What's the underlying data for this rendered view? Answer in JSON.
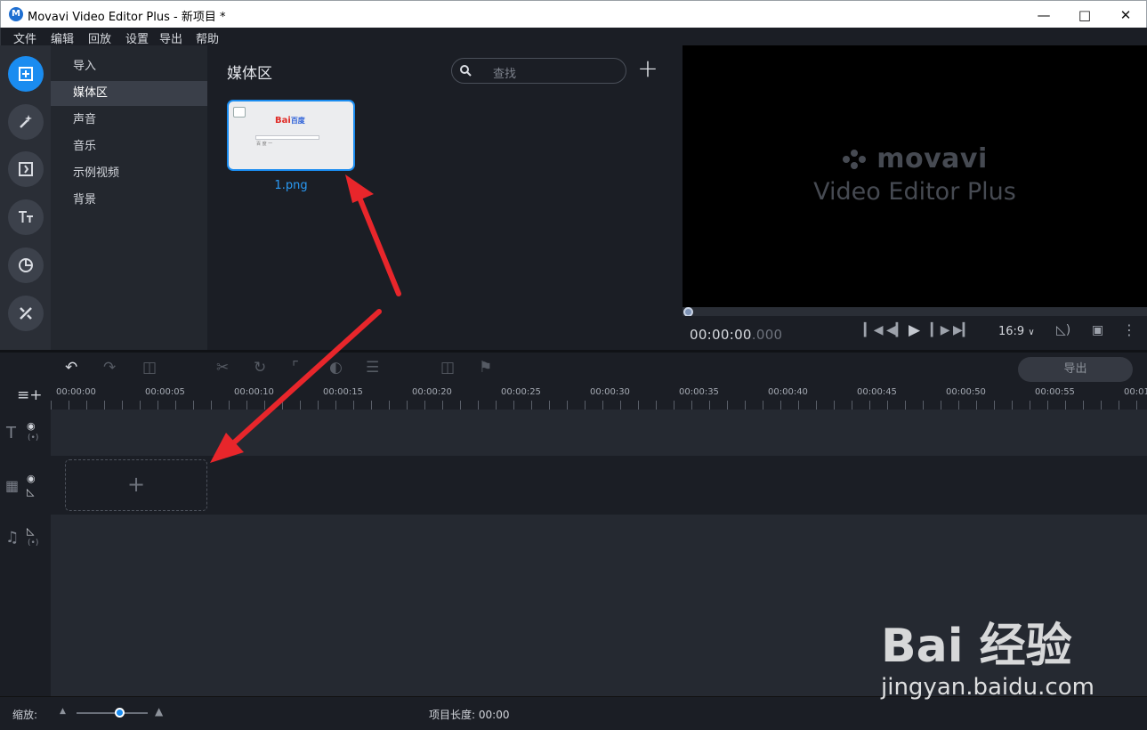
{
  "window": {
    "title": "Movavi Video Editor Plus - 新项目 *",
    "app_icon": "movavi-icon",
    "controls": [
      "minimize-icon",
      "maximize-icon",
      "close-icon"
    ]
  },
  "menu": [
    "文件",
    "编辑",
    "回放",
    "设置",
    "导出",
    "帮助"
  ],
  "rail": {
    "icons": [
      "import-icon",
      "magic-wand-icon",
      "transition-icon",
      "text-icon",
      "sticker-icon",
      "tools-icon"
    ],
    "active_index": 0
  },
  "categories": {
    "items": [
      "导入",
      "媒体区",
      "声音",
      "音乐",
      "示例视频",
      "背景"
    ],
    "selected_index": 1
  },
  "media": {
    "title": "媒体区",
    "search_placeholder": "查找",
    "add_label": "+",
    "items": [
      {
        "label": "1.png",
        "thumb_logo": "Bai",
        "thumb_logo2": "百度",
        "thumb_text": "百 度 一"
      }
    ]
  },
  "preview": {
    "brand": "movavi",
    "subtitle": "Video Editor Plus",
    "timecode_main": "00:00:00",
    "timecode_frac": ".000",
    "aspect": "16:9",
    "aspect_caret": "∨"
  },
  "timeline": {
    "export_label": "导出",
    "ruler": [
      "00:00:00",
      "00:00:05",
      "00:00:10",
      "00:00:15",
      "00:00:20",
      "00:00:25",
      "00:00:30",
      "00:00:35",
      "00:00:40",
      "00:00:45",
      "00:00:50",
      "00:00:55",
      "00:01"
    ],
    "dropzone_label": "+"
  },
  "status": {
    "zoom_label": "缩放:",
    "zoom_level": 0.6,
    "project_length_label": "项目长度:",
    "project_length": "00:00"
  },
  "watermark": {
    "line1": "Bai 经验",
    "line2": "jingyan.baidu.com"
  },
  "colors": {
    "accent": "#1a8cf0",
    "annotation_arrow": "#e8262b"
  }
}
